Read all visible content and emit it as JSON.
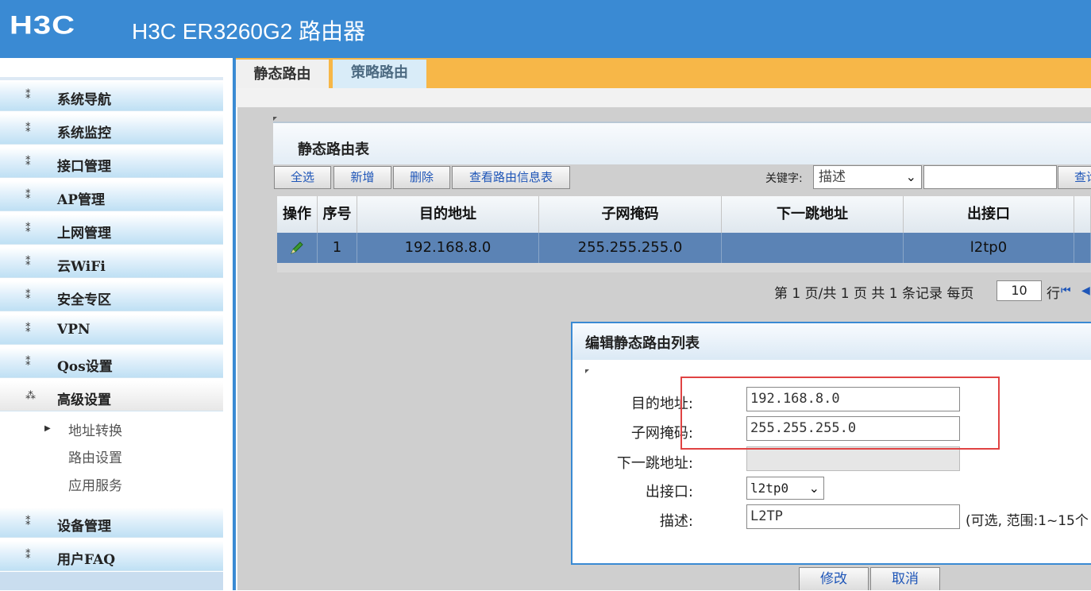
{
  "header": {
    "logo": "H3C",
    "title": "H3C ER3260G2 路由器"
  },
  "sidebar": {
    "items": [
      {
        "label": "系统导航"
      },
      {
        "label": "系统监控"
      },
      {
        "label": "接口管理"
      },
      {
        "label": "AP管理"
      },
      {
        "label": "上网管理"
      },
      {
        "label": "云WiFi"
      },
      {
        "label": "安全专区"
      },
      {
        "label": "VPN"
      },
      {
        "label": "Qos设置"
      },
      {
        "label": "高级设置"
      },
      {
        "label": "设备管理"
      },
      {
        "label": "用户FAQ"
      }
    ],
    "subitems": [
      {
        "label": "地址转换"
      },
      {
        "label": "路由设置"
      },
      {
        "label": "应用服务"
      }
    ]
  },
  "tabs": [
    {
      "label": "静态路由"
    },
    {
      "label": "策略路由"
    }
  ],
  "panel": {
    "title": "静态路由表",
    "buttons": {
      "select_all": "全选",
      "add": "新增",
      "delete": "删除",
      "view_routes": "查看路由信息表"
    },
    "keyword_label": "关键字:",
    "keyword_select": "描述",
    "search_button": "查询"
  },
  "table": {
    "headers": [
      "操作",
      "序号",
      "目的地址",
      "子网掩码",
      "下一跳地址",
      "出接口"
    ],
    "rows": [
      {
        "index": "1",
        "dest": "192.168.8.0",
        "mask": "255.255.255.0",
        "next_hop": "",
        "iface": "l2tp0"
      }
    ]
  },
  "pager": {
    "text": "第 1 页/共 1 页 共 1 条记录 每页",
    "per_page": "10",
    "row_unit": "行"
  },
  "dialog": {
    "title": "编辑静态路由列表",
    "fields": {
      "dest_label": "目的地址:",
      "dest_value": "192.168.8.0",
      "mask_label": "子网掩码:",
      "mask_value": "255.255.255.0",
      "next_hop_label": "下一跳地址:",
      "next_hop_value": "",
      "iface_label": "出接口:",
      "iface_value": "l2tp0",
      "desc_label": "描述:",
      "desc_value": "L2TP",
      "desc_hint": "(可选, 范围:1~15个"
    },
    "buttons": {
      "modify": "修改",
      "cancel": "取消"
    }
  },
  "colors": {
    "header": "#3a8ad3",
    "tab_bar": "#f7b748",
    "selected_row": "#5b83b5",
    "highlight": "#e04343"
  }
}
